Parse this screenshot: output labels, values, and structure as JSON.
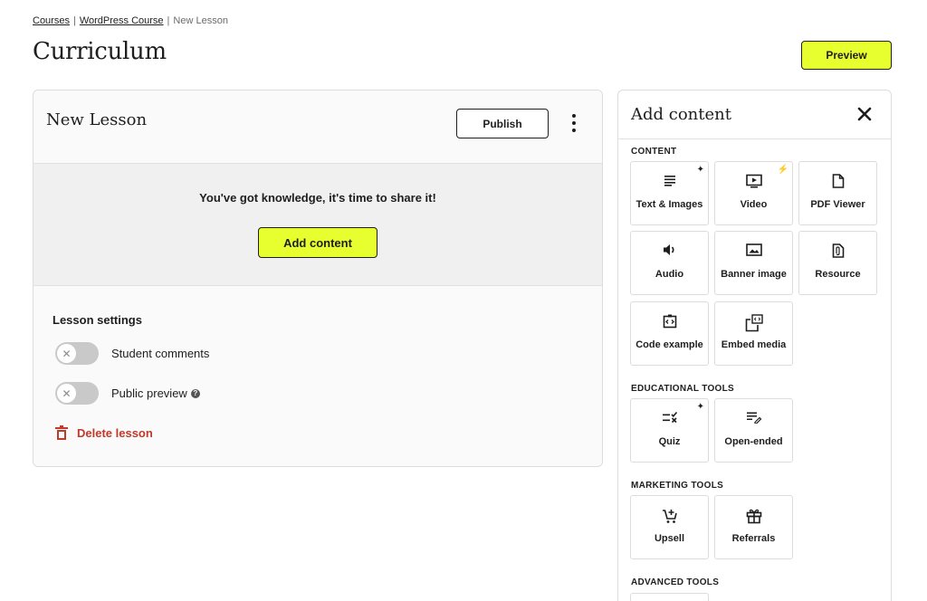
{
  "breadcrumb": {
    "items": [
      "Courses",
      "WordPress Course",
      "New Lesson"
    ],
    "separator": "|"
  },
  "page": {
    "title": "Curriculum",
    "preview_label": "Preview"
  },
  "lesson": {
    "name": "New Lesson",
    "publish_label": "Publish",
    "empty_message": "You've got knowledge, it's time to share it!",
    "add_content_label": "Add content",
    "settings_title": "Lesson settings",
    "toggles": [
      {
        "label": "Student comments",
        "enabled": false
      },
      {
        "label": "Public preview",
        "enabled": false,
        "help": "?"
      }
    ],
    "delete_label": "Delete lesson"
  },
  "panel": {
    "title": "Add content",
    "sections": {
      "content": {
        "label": "CONTENT",
        "tiles": [
          {
            "label": "Text & Images",
            "icon": "text-lines-icon",
            "badge": "✦"
          },
          {
            "label": "Video",
            "icon": "video-play-icon",
            "badge": "⚡"
          },
          {
            "label": "PDF Viewer",
            "icon": "document-icon"
          },
          {
            "label": "Audio",
            "icon": "speaker-icon"
          },
          {
            "label": "Banner image",
            "icon": "image-icon"
          },
          {
            "label": "Resource",
            "icon": "attachment-file-icon"
          },
          {
            "label": "Code example",
            "icon": "code-icon"
          },
          {
            "label": "Embed media",
            "icon": "embed-media-icon"
          }
        ]
      },
      "educational": {
        "label": "EDUCATIONAL TOOLS",
        "tiles": [
          {
            "label": "Quiz",
            "icon": "quiz-icon",
            "badge": "✦"
          },
          {
            "label": "Open-ended",
            "icon": "open-ended-icon"
          }
        ]
      },
      "marketing": {
        "label": "MARKETING TOOLS",
        "tiles": [
          {
            "label": "Upsell",
            "icon": "cart-plus-icon"
          },
          {
            "label": "Referrals",
            "icon": "gift-icon"
          }
        ]
      },
      "advanced": {
        "label": "ADVANCED TOOLS"
      }
    }
  },
  "colors": {
    "accent": "#e8ff2f",
    "danger": "#c0392b",
    "text": "#1e1e1e",
    "border": "#dcdcdc"
  }
}
